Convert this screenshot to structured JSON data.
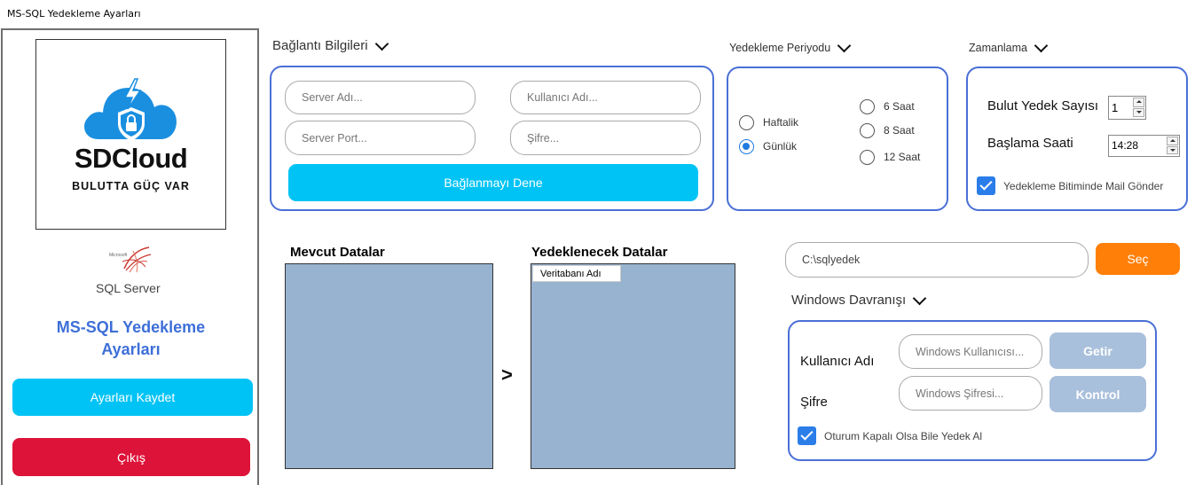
{
  "window": {
    "title": "MS-SQL Yedekleme Ayarları"
  },
  "sidebar": {
    "logo": {
      "name": "SDCloud",
      "tagline": "BULUTTA GÜÇ VAR"
    },
    "sql_logo": {
      "brand": "Microsoft",
      "product": "SQL Server"
    },
    "app_title": "MS-SQL Yedekleme Ayarları",
    "save_label": "Ayarları Kaydet",
    "exit_label": "Çıkış",
    "colors": {
      "save": "#00c3f5",
      "exit": "#dd1339",
      "title": "#3d6fd8"
    }
  },
  "connection": {
    "header": "Bağlantı Bilgileri",
    "server_name_placeholder": "Server Adı...",
    "username_placeholder": "Kullanıcı Adı...",
    "server_port_placeholder": "Server Port...",
    "password_placeholder": "Şifre...",
    "connect_label": "Bağlanmayı Dene"
  },
  "period": {
    "header": "Yedekleme Periyodu",
    "options": [
      "Haftalik",
      "Günlük",
      "6 Saat",
      "8 Saat",
      "12 Saat"
    ],
    "selected": "Günlük"
  },
  "schedule": {
    "header": "Zamanlama",
    "cloud_count_label": "Bulut Yedek Sayısı",
    "cloud_count_value": "1",
    "start_time_label": "Başlama Saati",
    "start_time_value": "14:28",
    "mail_label": "Yedekleme Bitiminde Mail Gönder",
    "mail_checked": true
  },
  "data": {
    "available_label": "Mevcut Datalar",
    "backup_label": "Yedeklenecek Datalar",
    "move_label": ">",
    "backup_column": "Veritabanı Adı"
  },
  "path": {
    "value": "C:\\sqlyedek",
    "select_label": "Seç"
  },
  "windows": {
    "header": "Windows Davranışı",
    "user_label": "Kullanıcı Adı",
    "password_label": "Şifre",
    "user_placeholder": "Windows Kullanıcısı...",
    "password_placeholder": "Windows Şifresi...",
    "fetch_label": "Getir",
    "check_label": "Kontrol",
    "offline_label": "Oturum Kapalı Olsa Bile Yedek Al",
    "offline_checked": true
  }
}
